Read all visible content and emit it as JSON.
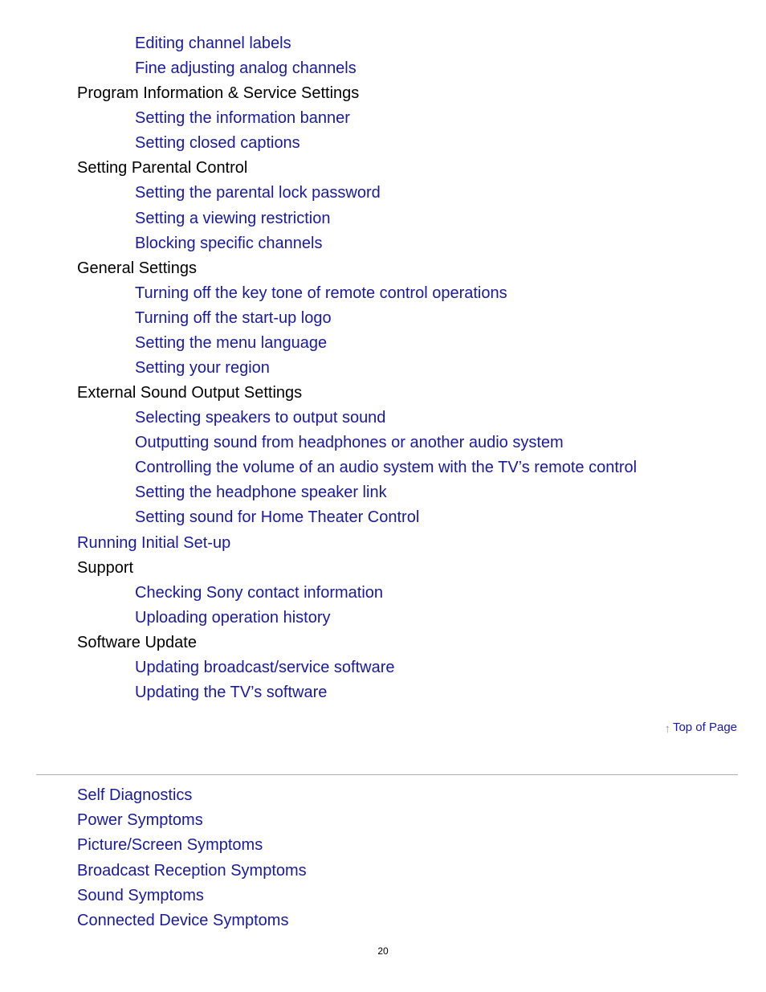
{
  "toc": [
    {
      "level": 2,
      "type": "link",
      "text": "Editing channel labels"
    },
    {
      "level": 2,
      "type": "link",
      "text": "Fine adjusting analog channels"
    },
    {
      "level": 1,
      "type": "heading",
      "text": "Program Information & Service Settings"
    },
    {
      "level": 2,
      "type": "link",
      "text": "Setting the information banner"
    },
    {
      "level": 2,
      "type": "link",
      "text": "Setting closed captions"
    },
    {
      "level": 1,
      "type": "heading",
      "text": "Setting Parental Control"
    },
    {
      "level": 2,
      "type": "link",
      "text": "Setting the parental lock password"
    },
    {
      "level": 2,
      "type": "link",
      "text": "Setting a viewing restriction"
    },
    {
      "level": 2,
      "type": "link",
      "text": "Blocking specific channels"
    },
    {
      "level": 1,
      "type": "heading",
      "text": "General Settings"
    },
    {
      "level": 2,
      "type": "link",
      "text": "Turning off the key tone of remote control operations"
    },
    {
      "level": 2,
      "type": "link",
      "text": "Turning off the start-up logo"
    },
    {
      "level": 2,
      "type": "link",
      "text": "Setting the menu language"
    },
    {
      "level": 2,
      "type": "link",
      "text": "Setting your region"
    },
    {
      "level": 1,
      "type": "heading",
      "text": "External Sound Output Settings"
    },
    {
      "level": 2,
      "type": "link",
      "text": "Selecting speakers to output sound"
    },
    {
      "level": 2,
      "type": "link",
      "text": "Outputting sound from headphones or another audio system"
    },
    {
      "level": 2,
      "type": "link",
      "text": "Controlling the volume of an audio system with the TV’s remote control"
    },
    {
      "level": 2,
      "type": "link",
      "text": "Setting the headphone speaker link"
    },
    {
      "level": 2,
      "type": "link",
      "text": "Setting sound for Home Theater Control"
    },
    {
      "level": 1,
      "type": "link",
      "text": "Running Initial Set-up"
    },
    {
      "level": 1,
      "type": "heading",
      "text": "Support"
    },
    {
      "level": 2,
      "type": "link",
      "text": "Checking Sony contact information"
    },
    {
      "level": 2,
      "type": "link",
      "text": "Uploading operation history"
    },
    {
      "level": 1,
      "type": "heading",
      "text": "Software Update"
    },
    {
      "level": 2,
      "type": "link",
      "text": "Updating broadcast/service software"
    },
    {
      "level": 2,
      "type": "link",
      "text": "Updating the TV’s software"
    }
  ],
  "top_of_page": {
    "icon": "arrow-up-icon",
    "arrow_glyph": "↑",
    "label": "Top of Page"
  },
  "bottom_links": [
    "Self Diagnostics",
    "Power Symptoms",
    "Picture/Screen Symptoms",
    "Broadcast Reception Symptoms",
    "Sound Symptoms",
    "Connected Device Symptoms"
  ],
  "page_number": "20",
  "colors": {
    "link": "#1a1a9c",
    "heading": "#000000",
    "divider": "#b0b0b0"
  }
}
